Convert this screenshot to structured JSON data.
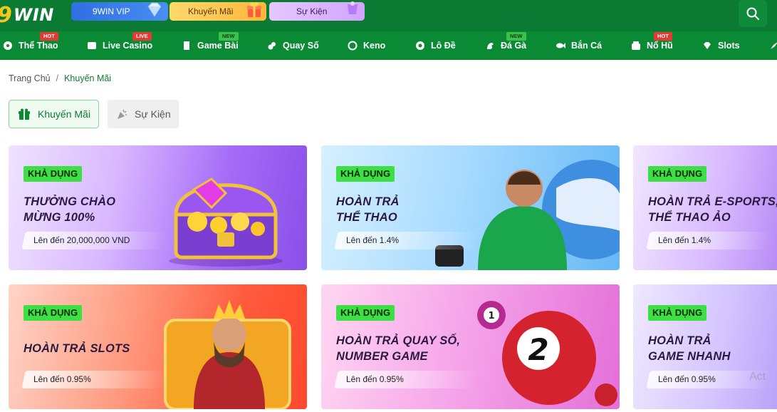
{
  "header": {
    "logo_nine": "9",
    "logo_win": "WIN",
    "vip_label": "9WIN VIP",
    "promo_label": "Khuyến Mãi",
    "event_label": "Sự Kiện"
  },
  "nav": {
    "items": [
      {
        "label": "Thể Thao",
        "badge": "HOT"
      },
      {
        "label": "Live Casino",
        "badge": "LIVE"
      },
      {
        "label": "Game Bài",
        "badge": "NEW"
      },
      {
        "label": "Quay Số",
        "badge": ""
      },
      {
        "label": "Keno",
        "badge": ""
      },
      {
        "label": "Lô Đề",
        "badge": ""
      },
      {
        "label": "Đá Gà",
        "badge": "NEW"
      },
      {
        "label": "Bắn Cá",
        "badge": ""
      },
      {
        "label": "Nổ Hũ",
        "badge": "HOT"
      },
      {
        "label": "Slots",
        "badge": ""
      }
    ]
  },
  "breadcrumb": {
    "home": "Trang Chủ",
    "separator": "/",
    "current": "Khuyến Mãi"
  },
  "tabs": {
    "promo": "Khuyến Mãi",
    "event": "Sự Kiện"
  },
  "cards": [
    {
      "tag": "KHẢ DỤNG",
      "title_line1": "THƯỞNG CHÀO",
      "title_line2": "MỪNG 100%",
      "pill": "Lên đến 20,000,000 VND"
    },
    {
      "tag": "KHẢ DỤNG",
      "title_line1": "HOÀN TRẢ",
      "title_line2": "THỂ THAO",
      "pill": "Lên đến 1.4%"
    },
    {
      "tag": "KHẢ DỤNG",
      "title_line1": "HOÀN TRẢ E-SPORTS,",
      "title_line2": "THỂ THAO ẢO",
      "pill": "Lên đến 1.4%"
    },
    {
      "tag": "KHẢ DỤNG",
      "title_line1": "HOÀN TRẢ SLOTS",
      "title_line2": "",
      "pill": "Lên đến 0.95%"
    },
    {
      "tag": "KHẢ DỤNG",
      "title_line1": "HOÀN TRẢ QUAY SỐ,",
      "title_line2": "NUMBER GAME",
      "pill": "Lên đến 0.95%"
    },
    {
      "tag": "KHẢ DỤNG",
      "title_line1": "HOÀN TRẢ",
      "title_line2": "GAME NHANH",
      "pill": "Lên đến 0.95%"
    }
  ],
  "ball_numbers": {
    "small": "1",
    "big": "2"
  },
  "watermark": "Act"
}
